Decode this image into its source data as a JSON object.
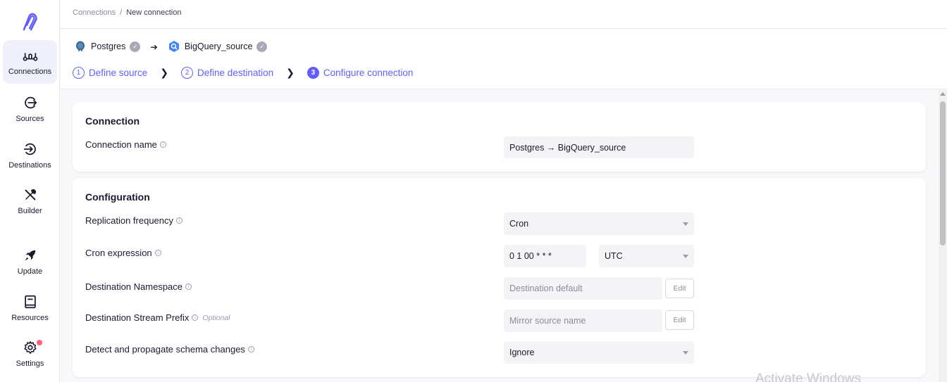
{
  "breadcrumb": {
    "parent": "Connections",
    "separator": "/",
    "current": "New connection"
  },
  "route": {
    "source": "Postgres",
    "destination": "BigQuery_source",
    "arrow": "➔"
  },
  "steps": [
    {
      "num": "1",
      "label": "Define source"
    },
    {
      "num": "2",
      "label": "Define destination"
    },
    {
      "num": "3",
      "label": "Configure connection"
    }
  ],
  "sidebar": {
    "items": [
      {
        "label": "Connections",
        "icon": "connections-icon"
      },
      {
        "label": "Sources",
        "icon": "sources-icon"
      },
      {
        "label": "Destinations",
        "icon": "destinations-icon"
      },
      {
        "label": "Builder",
        "icon": "builder-icon"
      },
      {
        "label": "Update",
        "icon": "rocket-icon"
      },
      {
        "label": "Resources",
        "icon": "book-icon"
      },
      {
        "label": "Settings",
        "icon": "gear-icon"
      }
    ]
  },
  "connection": {
    "title": "Connection",
    "name_label": "Connection name",
    "name_value": "Postgres → BigQuery_source"
  },
  "configuration": {
    "title": "Configuration",
    "frequency_label": "Replication frequency",
    "frequency_value": "Cron",
    "cron_label": "Cron expression",
    "cron_value": "0 1 00 * * *",
    "timezone_value": "UTC",
    "namespace_label": "Destination Namespace",
    "namespace_placeholder": "Destination default",
    "prefix_label": "Destination Stream Prefix",
    "prefix_optional": "Optional",
    "prefix_placeholder": "Mirror source name",
    "schema_label": "Detect and propagate schema changes",
    "schema_value": "Ignore",
    "edit_label": "Edit"
  },
  "watermark": "Activate Windows",
  "colors": {
    "accent": "#615eff",
    "badge": "#ff5e7b"
  }
}
